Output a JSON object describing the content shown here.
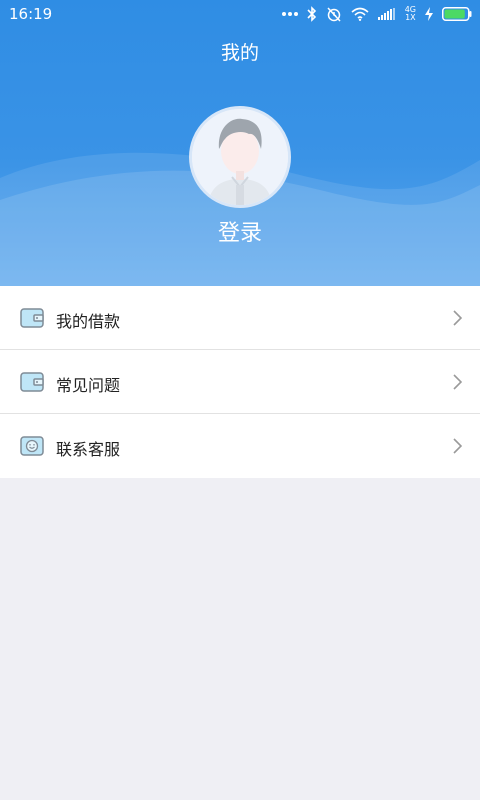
{
  "status_bar": {
    "time": "16:19",
    "network_top": "4G",
    "network_bottom": "1X",
    "icons": [
      "more-icon",
      "bluetooth-icon",
      "alarm-off-icon",
      "wifi-icon",
      "signal-icon",
      "charging-icon",
      "battery-icon"
    ],
    "battery_level": 0.9,
    "battery_color": "#4cd964"
  },
  "header": {
    "title": "我的",
    "login_label": "登录",
    "avatar_icon": "user-avatar-placeholder",
    "background_color": "#3290e5"
  },
  "menu": {
    "items": [
      {
        "label": "我的借款",
        "icon": "wallet-icon"
      },
      {
        "label": "常见问题",
        "icon": "card-icon"
      },
      {
        "label": "联系客服",
        "icon": "chat-icon"
      }
    ],
    "chevron_icon": "chevron-right-icon"
  },
  "colors": {
    "accent": "#3290e5",
    "page_background": "#efeff4",
    "icon_fill": "#bfe6f7",
    "icon_stroke": "#7f8b96"
  }
}
